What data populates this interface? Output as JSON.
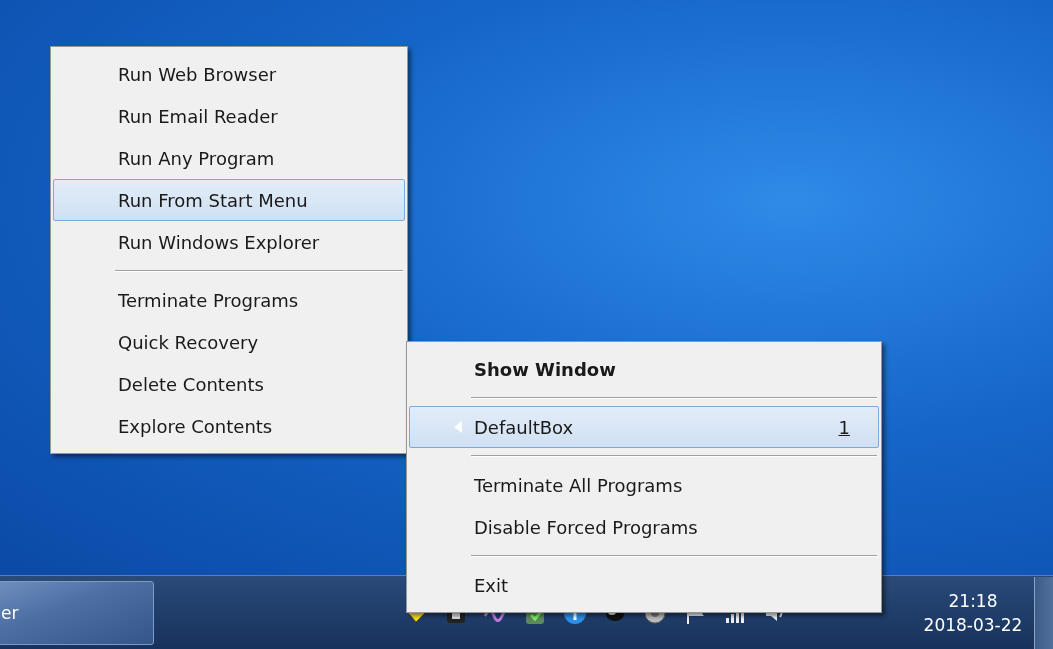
{
  "submenu": {
    "items": [
      {
        "kind": "item",
        "label": "Run Web Browser",
        "selected": false
      },
      {
        "kind": "item",
        "label": "Run Email Reader",
        "selected": false
      },
      {
        "kind": "item",
        "label": "Run Any Program",
        "selected": false
      },
      {
        "kind": "item",
        "label": "Run From Start Menu",
        "selected": true
      },
      {
        "kind": "item",
        "label": "Run Windows Explorer",
        "selected": false
      },
      {
        "kind": "separator"
      },
      {
        "kind": "item",
        "label": "Terminate Programs",
        "selected": false
      },
      {
        "kind": "item",
        "label": "Quick Recovery",
        "selected": false
      },
      {
        "kind": "item",
        "label": "Delete Contents",
        "selected": false
      },
      {
        "kind": "item",
        "label": "Explore Contents",
        "selected": false
      }
    ]
  },
  "tray_menu": {
    "items": [
      {
        "kind": "item",
        "label": "Show Window",
        "default": true,
        "selected": false
      },
      {
        "kind": "separator"
      },
      {
        "kind": "submenu",
        "label": "DefaultBox",
        "shortcut": "1",
        "selected": true
      },
      {
        "kind": "separator"
      },
      {
        "kind": "item",
        "label": "Terminate All Programs",
        "default": false,
        "selected": false
      },
      {
        "kind": "item",
        "label": "Disable Forced Programs",
        "default": false,
        "selected": false
      },
      {
        "kind": "separator"
      },
      {
        "kind": "item",
        "label": "Exit",
        "default": false,
        "selected": false
      }
    ]
  },
  "taskbar": {
    "button_label": "er",
    "clock": {
      "time": "21:18",
      "date": "2018-03-22"
    }
  }
}
